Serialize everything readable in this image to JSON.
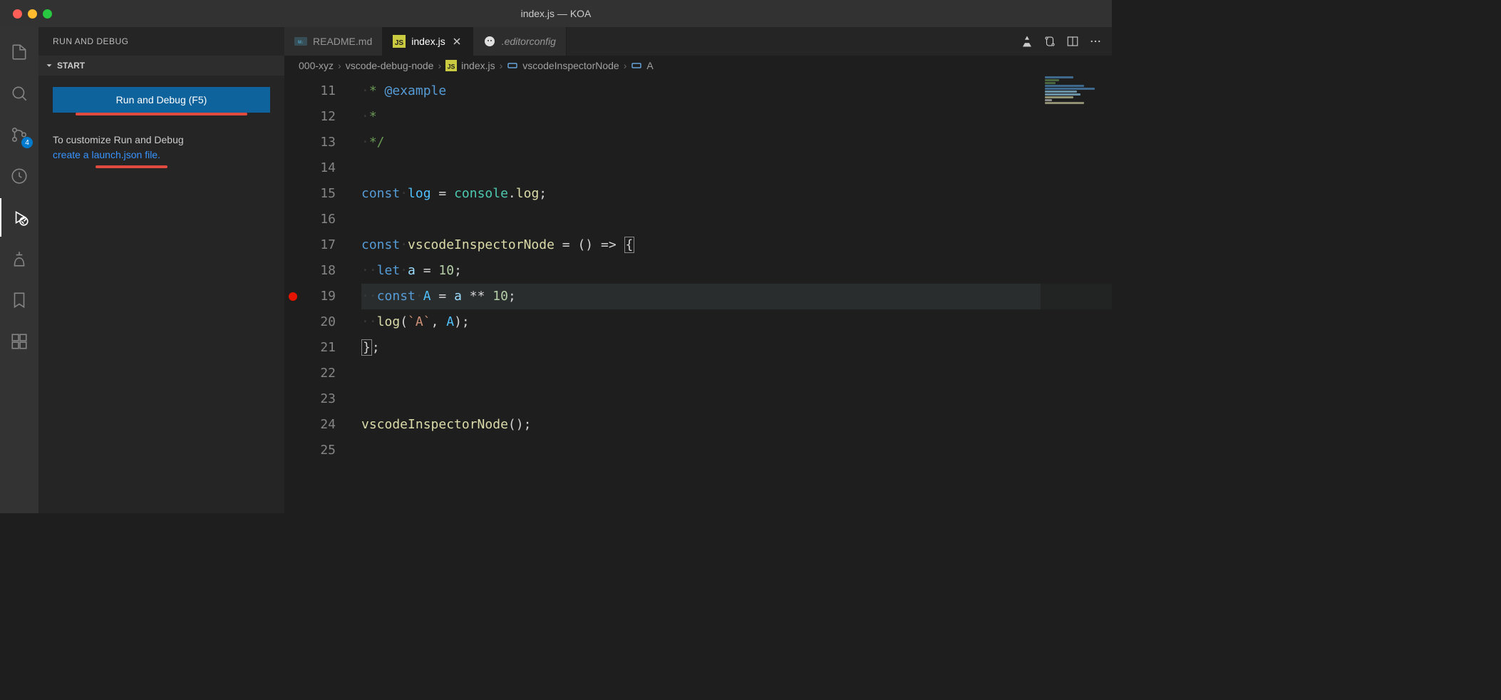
{
  "window": {
    "title": "index.js — KOA"
  },
  "activitybar": {
    "scm_badge": "4"
  },
  "sidebar": {
    "title": "RUN AND DEBUG",
    "section": "START",
    "runButton": "Run and Debug (F5)",
    "customizeText": "To customize Run and Debug",
    "launchLink": "create a launch.json file"
  },
  "tabs": [
    {
      "label": "README.md",
      "icon": "markdown",
      "active": false
    },
    {
      "label": "index.js",
      "icon": "js",
      "active": true
    },
    {
      "label": ".editorconfig",
      "icon": "editorconfig",
      "active": false,
      "italic": true
    }
  ],
  "breadcrumbs": {
    "parts": [
      "000-xyz",
      "vscode-debug-node",
      "index.js",
      "vscodeInspectorNode",
      "A"
    ]
  },
  "editor": {
    "startLine": 11,
    "breakpointLine": 19,
    "highlightLine": 19,
    "lines": [
      {
        "n": 11,
        "tokens": [
          [
            "ws",
            "·"
          ],
          [
            "comment",
            "* "
          ],
          [
            "doctag",
            "@example"
          ]
        ]
      },
      {
        "n": 12,
        "tokens": [
          [
            "ws",
            "·"
          ],
          [
            "comment",
            "*"
          ]
        ]
      },
      {
        "n": 13,
        "tokens": [
          [
            "ws",
            "·"
          ],
          [
            "comment",
            "*/"
          ]
        ]
      },
      {
        "n": 14,
        "tokens": []
      },
      {
        "n": 15,
        "tokens": [
          [
            "keyword",
            "const"
          ],
          [
            "ws",
            "·"
          ],
          [
            "const",
            "log"
          ],
          [
            "op",
            " = "
          ],
          [
            "object",
            "console"
          ],
          [
            "punct",
            "."
          ],
          [
            "func",
            "log"
          ],
          [
            "punct",
            ";"
          ]
        ]
      },
      {
        "n": 16,
        "tokens": []
      },
      {
        "n": 17,
        "tokens": [
          [
            "keyword",
            "const"
          ],
          [
            "ws",
            "·"
          ],
          [
            "func",
            "vscodeInspectorNode"
          ],
          [
            "op",
            " = "
          ],
          [
            "punct",
            "()"
          ],
          [
            "op",
            " => "
          ],
          [
            "bracket",
            "{"
          ]
        ]
      },
      {
        "n": 18,
        "tokens": [
          [
            "ws",
            "··"
          ],
          [
            "keyword",
            "let"
          ],
          [
            "ws",
            "·"
          ],
          [
            "var",
            "a"
          ],
          [
            "op",
            " = "
          ],
          [
            "number",
            "10"
          ],
          [
            "punct",
            ";"
          ]
        ]
      },
      {
        "n": 19,
        "tokens": [
          [
            "ws",
            "··"
          ],
          [
            "keyword",
            "const"
          ],
          [
            "ws",
            "·"
          ],
          [
            "const",
            "A"
          ],
          [
            "op",
            " = "
          ],
          [
            "var",
            "a"
          ],
          [
            "op",
            " ** "
          ],
          [
            "number",
            "10"
          ],
          [
            "punct",
            ";"
          ]
        ]
      },
      {
        "n": 20,
        "tokens": [
          [
            "ws",
            "··"
          ],
          [
            "func",
            "log"
          ],
          [
            "punct",
            "("
          ],
          [
            "string",
            "`A`"
          ],
          [
            "punct",
            ", "
          ],
          [
            "const",
            "A"
          ],
          [
            "punct",
            ");"
          ]
        ]
      },
      {
        "n": 21,
        "tokens": [
          [
            "bracket",
            "}"
          ],
          [
            "punct",
            ";"
          ]
        ]
      },
      {
        "n": 22,
        "tokens": []
      },
      {
        "n": 23,
        "tokens": []
      },
      {
        "n": 24,
        "tokens": [
          [
            "func",
            "vscodeInspectorNode"
          ],
          [
            "punct",
            "();"
          ]
        ]
      },
      {
        "n": 25,
        "tokens": []
      }
    ]
  },
  "colors": {
    "accent": "#007acc"
  }
}
